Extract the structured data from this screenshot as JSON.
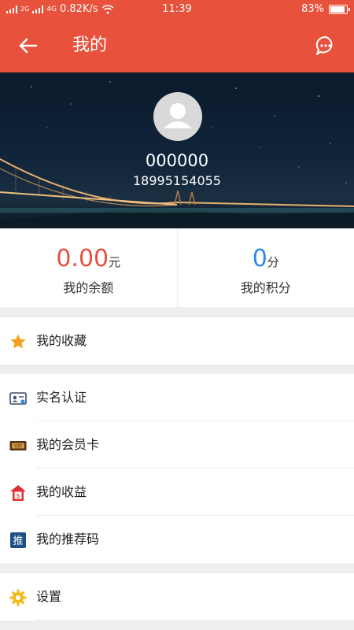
{
  "status_bar": {
    "network_small": "2G",
    "network_type": "4G",
    "speed": "0.82K/s",
    "time": "11:39",
    "battery_percent": "83%",
    "battery_level": 0.83
  },
  "app_bar": {
    "title": "我的",
    "back_icon": "arrow-left-icon",
    "message_icon": "chat-bubble-icon"
  },
  "profile": {
    "username": "000000",
    "phone": "18995154055"
  },
  "stats": [
    {
      "value": "0.00",
      "unit": "元",
      "label": "我的余额",
      "color": "#e8513c"
    },
    {
      "value": "0",
      "unit": "分",
      "label": "我的积分",
      "color": "#2d8ae8"
    }
  ],
  "menu": {
    "favorites": {
      "label": "我的收藏",
      "icon": "star-icon"
    },
    "verification": {
      "label": "实名认证",
      "icon": "id-card-icon"
    },
    "membership": {
      "label": "我的会员卡",
      "icon": "vip-card-icon"
    },
    "earnings": {
      "label": "我的收益",
      "icon": "earnings-house-icon"
    },
    "referral": {
      "label": "我的推荐码",
      "icon": "referral-code-icon"
    },
    "settings": {
      "label": "设置",
      "icon": "gear-icon"
    }
  },
  "colors": {
    "accent": "#e8513c",
    "background": "#eeeeee"
  }
}
